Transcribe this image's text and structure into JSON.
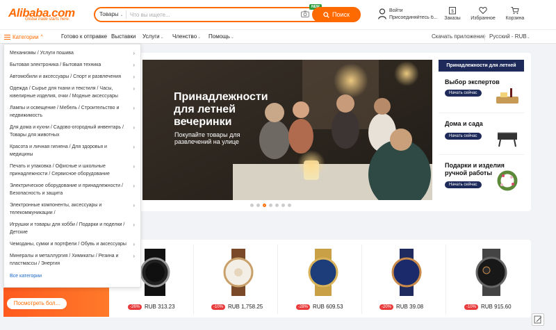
{
  "header": {
    "logo_text": "Alibaba.com",
    "logo_tagline": "Global trade starts here.",
    "search_category": "Товары",
    "search_placeholder": "Что вы ищете...",
    "new_badge": "NEW",
    "search_button": "Поиск",
    "signin_line1": "Войти",
    "signin_line2": "Присоединяйтесь б...",
    "orders": "Заказы",
    "favorites": "Избранное",
    "cart": "Корзина"
  },
  "nav": {
    "categories": "Категории",
    "links": [
      "Готово к отправке",
      "Выставки",
      "Услуги",
      "Членство",
      "Помощь"
    ],
    "app": "Скачать приложение",
    "language": "Русский - RUB"
  },
  "categories": {
    "items": [
      "Механизмы / Услуги пошива",
      "Бытовая электроника / Бытовая техника",
      "Автомобили и аксессуары / Спорт и развлечения",
      "Одежда / Сырье для ткани и текстиля / Часы, ювелирные изделия, очки / Модные аксессуары",
      "Лампы и освещение / Мебель / Строительство и недвижимость",
      "Для дома и кухни / Садово-огородный инвентарь / Товары для животных",
      "Красота и личная гигиена / Для здоровья и медицины",
      "Печать и упаковка / Офисные и школьные принадлежности / Сервисное оборудование",
      "Электрическое оборудование и принадлежности / Безопасность и защита",
      "Электронные компоненты, аксессуары и телекоммуникации /",
      "Игрушки и товары для хобби / Подарки и поделки / Детские",
      "Чемоданы, сумки и портфели / Обувь и аксессуары",
      "Минералы и металлургия / Химикаты / Резина и пластмассы / Энергия"
    ],
    "all": "Все категории"
  },
  "banner": {
    "title": "Принадлежности для летней вечеринки",
    "subtitle": "Покупайте товары для развлечений на улице"
  },
  "side_panel": {
    "header": "Принадлежности для летней",
    "tiles": [
      {
        "title": "Выбор экспертов",
        "button": "Начать сейчас"
      },
      {
        "title": "Дома и сада",
        "button": "Начать сейчас"
      },
      {
        "title": "Подарки и изделия ручной работы",
        "button": "Начать сейчас"
      }
    ]
  },
  "promo": {
    "button": "Посмотреть бол..."
  },
  "products": [
    {
      "discount": "-26%",
      "price": "RUB 313.23"
    },
    {
      "discount": "-10%",
      "price": "RUB 1,758.25"
    },
    {
      "discount": "-28%",
      "price": "RUB 609.53"
    },
    {
      "discount": "-20%",
      "price": "RUB 39.08"
    },
    {
      "discount": "-10%",
      "price": "RUB 915.60"
    }
  ],
  "colors": {
    "accent": "#ff6a00",
    "navy": "#1d2a5a",
    "discount": "#e93b3b"
  }
}
